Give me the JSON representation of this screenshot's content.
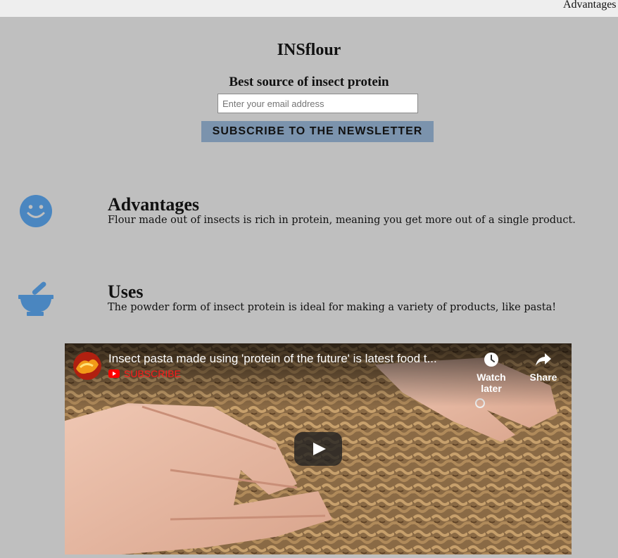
{
  "nav": {
    "link_label": "Advantages"
  },
  "header": {
    "title": "INSflour",
    "tagline": "Best source of insect protein",
    "email_placeholder": "Enter your email address",
    "subscribe_label": "SUBSCRIBE TO THE NEWSLETTER"
  },
  "features": [
    {
      "heading": "Advantages",
      "text": "Flour made out of insects is rich in protein, meaning you get more out of a single product.",
      "icon": "smile-icon"
    },
    {
      "heading": "Uses",
      "text": "The powder form of insect protein is ideal for making a variety of products, like pasta!",
      "icon": "mortar-pestle-icon"
    }
  ],
  "video": {
    "title": "Insect pasta made using 'protein of the future' is latest food t...",
    "subscribe_label": "SUBSCRIBE",
    "watch_later_label": "Watch later",
    "share_label": "Share"
  },
  "colors": {
    "background": "#bfbfbf",
    "nav_bar": "#eeeeee",
    "button": "#7b93ad",
    "icon": "#4a86c0",
    "youtube_red": "#ff0000"
  }
}
